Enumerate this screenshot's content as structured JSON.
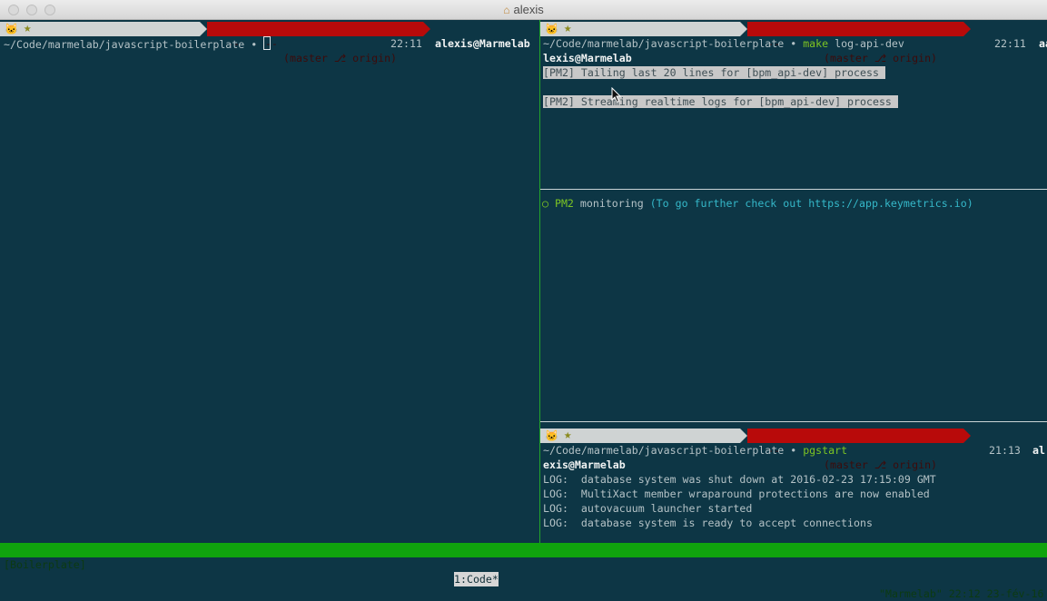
{
  "window": {
    "title": "alexis"
  },
  "powerline": {
    "branch": "(master ⎇ origin)",
    "dashes": "--    --"
  },
  "left_pane": {
    "prompt_path": "~/Code/marmelab/javascript-boilerplate ",
    "prompt_dot": "•",
    "time": "22:11",
    "user": "alexis@Marmelab"
  },
  "top_right_pane": {
    "prompt_path": "~/Code/marmelab/javascript-boilerplate ",
    "prompt_dot": "•",
    "command": "make",
    "command_args": " log-api-dev",
    "time": "22:11",
    "user_cut": "aa",
    "user_line": "lexis@Marmelab",
    "log1": "[PM2] Tailing last 20 lines for [bpm_api-dev] process ",
    "log2": "[PM2] Streaming realtime logs for [bpm_api-dev] process "
  },
  "monitor_pane": {
    "bullet": "○",
    "pm2": "PM2",
    "monitoring": " monitoring ",
    "hint": "(To go further check out https://app.keymetrics.io)"
  },
  "bottom_right_pane": {
    "prompt_path": "~/Code/marmelab/javascript-boilerplate ",
    "prompt_dot": "•",
    "command": " pgstart",
    "time": "21:13",
    "user_cut": "al",
    "user_line": "exis@Marmelab",
    "logs": [
      "LOG:  database system was shut down at 2016-02-23 17:15:09 GMT",
      "LOG:  MultiXact member wraparound protections are now enabled",
      "LOG:  autovacuum launcher started",
      "LOG:  database system is ready to accept connections"
    ]
  },
  "tmux": {
    "session": "[Boilerplate]",
    "window": "1:Code*",
    "right": "\"Marmelab\" 22:12 23-fév-16"
  },
  "colors": {
    "background": "#0d3645",
    "status_green": "#10a30e",
    "powerline_red": "#b80a0a",
    "prompt_green": "#7cc424",
    "link_cyan": "#35b8c9"
  }
}
